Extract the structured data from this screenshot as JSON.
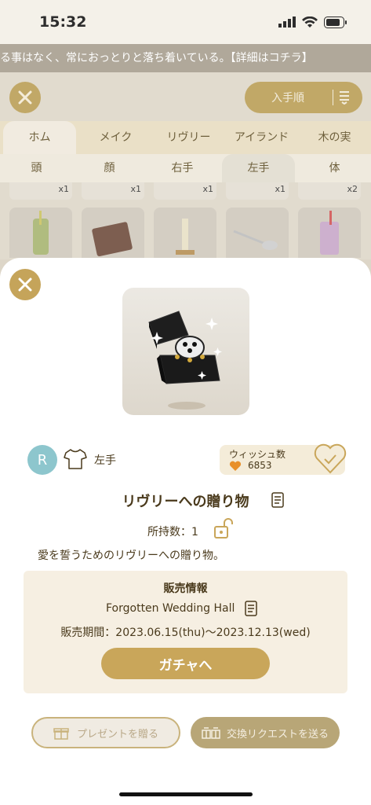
{
  "status": {
    "time": "15:32"
  },
  "ticker": {
    "text": "る事はなく、常におっとりと落ち着いている。【詳細はコチラ】"
  },
  "background": {
    "sort_label": "入手順",
    "categories": [
      "ホム",
      "メイク",
      "リヴリー",
      "アイランド",
      "木の実"
    ],
    "slots": [
      "頭",
      "顔",
      "右手",
      "左手",
      "体"
    ],
    "counts": [
      "x1",
      "x1",
      "x1",
      "x1",
      "x2"
    ]
  },
  "item": {
    "rarity": "R",
    "slot": "左手",
    "wish_label": "ウィッシュ数",
    "wish_count": "6853",
    "name": "リヴリーへの贈り物",
    "owned": "所持数：1",
    "description": "愛を誓うためのリヴリーへの贈り物。"
  },
  "sale": {
    "title": "販売情報",
    "source": "Forgotten Wedding Hall",
    "period": "販売期間：2023.06.15(thu)〜2023.12.13(wed)",
    "gacha_label": "ガチャへ"
  },
  "actions": {
    "present_label": "プレゼントを贈る",
    "trade_label": "交換リクエストを送る"
  },
  "colors": {
    "accent": "#c9a65a",
    "rarity_bg": "#8dc6cd",
    "wish_orange": "#e8902a"
  }
}
